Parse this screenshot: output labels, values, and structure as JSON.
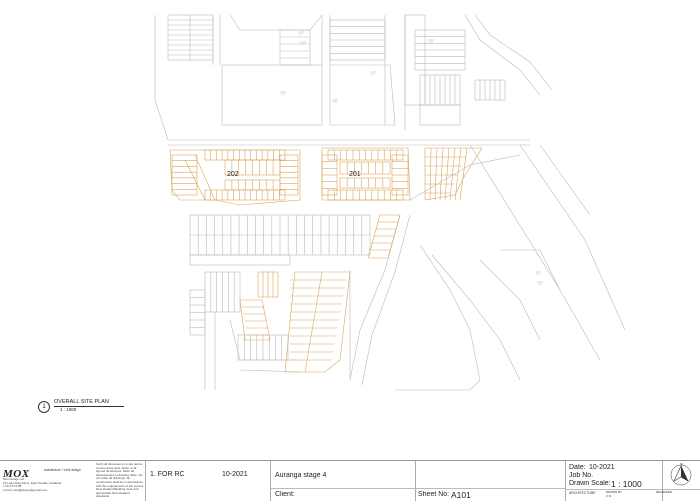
{
  "drawing": {
    "building_labels": [
      "202",
      "201"
    ],
    "site_plan": {
      "number": "1",
      "title": "OVERALL SITE PLAN",
      "scale": "1 : 1000"
    }
  },
  "title_block": {
    "logo": "MOX",
    "logo_tagline": "architecture + revit design",
    "company": "Mox Design Ltd.",
    "address": "15 Lady Ruby Drive, East Tamaki, Auckland",
    "phone": "t: 09 274 5 88",
    "email": "e:harry.mox@design@gmail.com",
    "notes": "Verify all dimensions on site before commencing work. Refer to all figured dimensions. Refer all discrepancies to drawing office. Do not scale off drawings. All construction shall be in accordance with the requirements of the current New Zealand Building code and appropriate New Zealand standards.",
    "revision": "1. FOR RC",
    "revision_date": "10-2021",
    "project": "Auranga stage 4",
    "client_label": "Client:",
    "date_label": "Date:",
    "date_value": "10-2021",
    "job_label": "Job No.",
    "scale_label": "Drawn Scale:",
    "scale_value": "1 : 1000",
    "sheet_label": "Sheet No:",
    "sheet_value": "A101",
    "discipline": "ARCHITECTURE",
    "drawn_by_label": "DRAWN BY",
    "drawn_by_value": "X.N.",
    "reviewed_label": "REVIEWED",
    "north_label": "N"
  }
}
